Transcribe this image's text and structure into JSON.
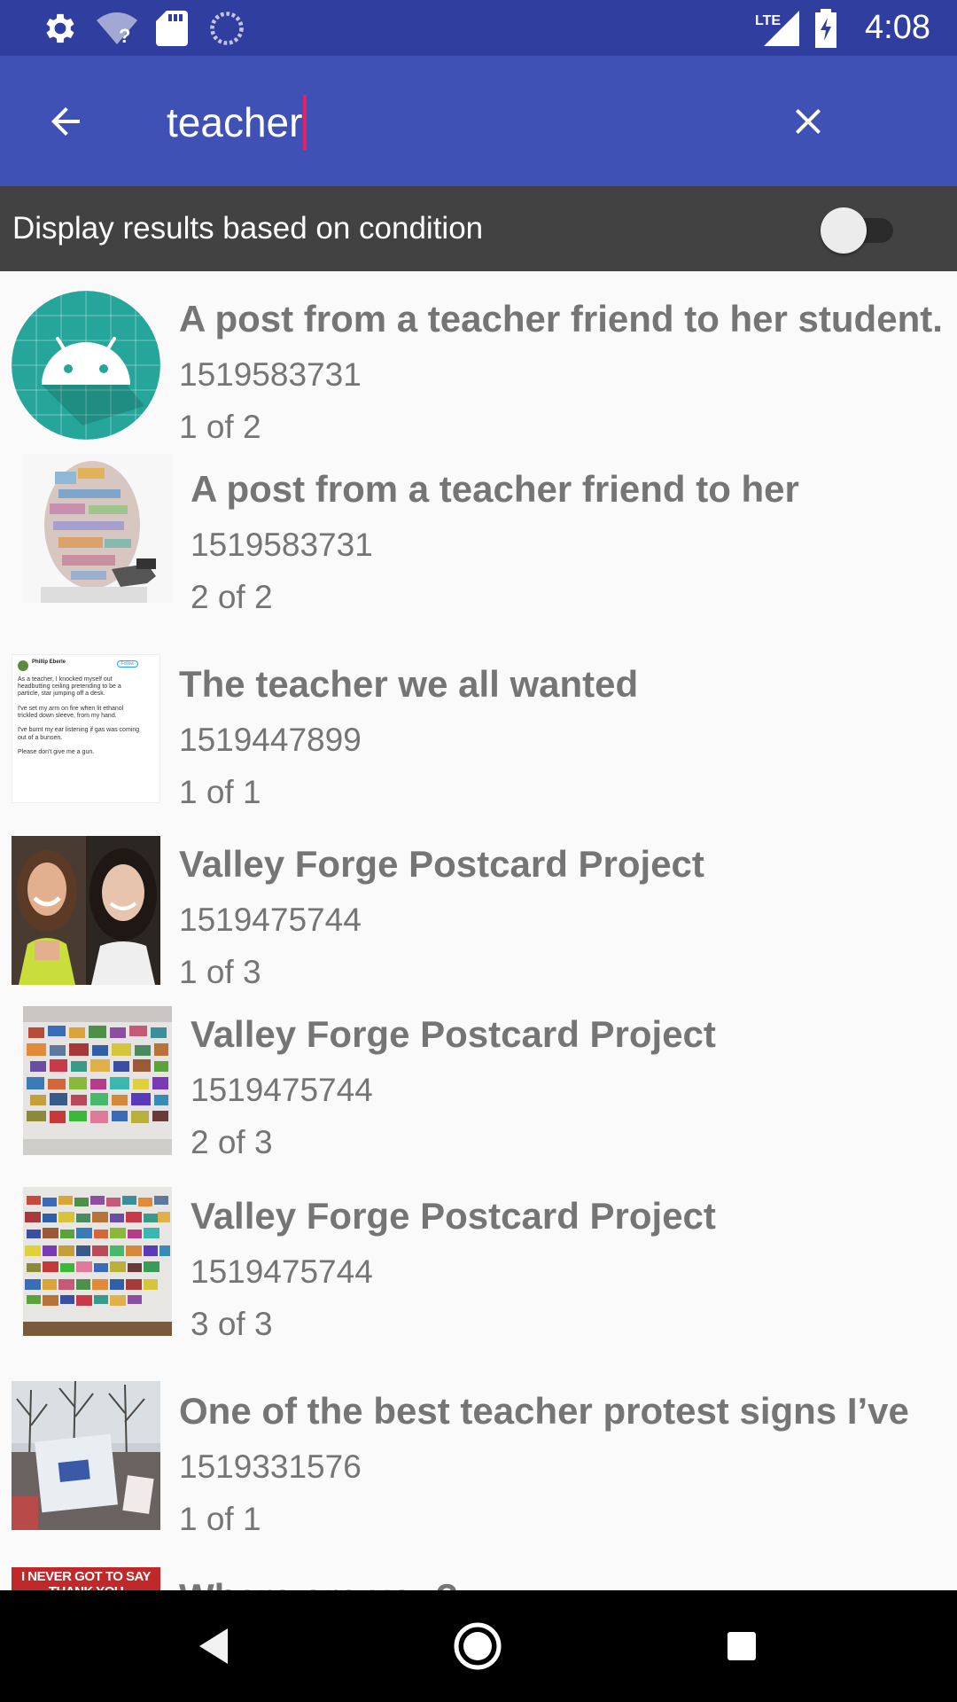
{
  "status_bar": {
    "time": "4:08",
    "network": "LTE",
    "icons": [
      "settings-icon",
      "wifi-unknown-icon",
      "sd-card-icon",
      "sync-icon",
      "lte-signal-icon",
      "battery-charging-icon"
    ]
  },
  "app_bar": {
    "back_icon": "arrow-back-icon",
    "search_value": "teacher",
    "clear_icon": "close-icon"
  },
  "condition_bar": {
    "label": "Display results based on condition",
    "toggle_on": false
  },
  "results": [
    {
      "title": "A post from a teacher friend to her student.",
      "id": "1519583731",
      "position": "1 of 2",
      "thumb": "android-default-icon"
    },
    {
      "title": "A post from a teacher friend to her",
      "id": "1519583731",
      "position": "2 of 2",
      "thumb": "cartoon-image"
    },
    {
      "title": "The teacher we all wanted",
      "id": "1519447899",
      "position": "1 of 1",
      "thumb": "tweet-screenshot-image"
    },
    {
      "title": "Valley Forge Postcard Project",
      "id": "1519475744",
      "position": "1 of 3",
      "thumb": "portrait-photo-image"
    },
    {
      "title": "Valley Forge Postcard Project",
      "id": "1519475744",
      "position": "2 of 3",
      "thumb": "postcard-wall-image"
    },
    {
      "title": "Valley Forge Postcard Project",
      "id": "1519475744",
      "position": "3 of 3",
      "thumb": "postcard-wall-image"
    },
    {
      "title": "One of the best teacher protest signs I’ve",
      "id": "1519331576",
      "position": "1 of 1",
      "thumb": "protest-sign-photo-image"
    },
    {
      "title": "Where are you?",
      "thumb": "meme-image",
      "thumb_text": "I NEVER GOT TO SAY THANK YOU"
    }
  ],
  "tweet_thumb": {
    "author": "Phillip Eberle",
    "follow": "Follow",
    "lines": [
      "As a teacher, I knocked myself out",
      "headbutting ceiling pretending to be a",
      "particle, star jumping off a desk.",
      "",
      "I've set my arm on fire when lit ethanol",
      "trickled down sleeve, from my hand.",
      "",
      "I've burnt my ear listening if gas was coming",
      "out of a bunsen.",
      "",
      "Please don't give me a gun."
    ]
  },
  "nav_bar": {
    "buttons": [
      "back-nav-icon",
      "home-nav-icon",
      "recents-nav-icon"
    ]
  }
}
